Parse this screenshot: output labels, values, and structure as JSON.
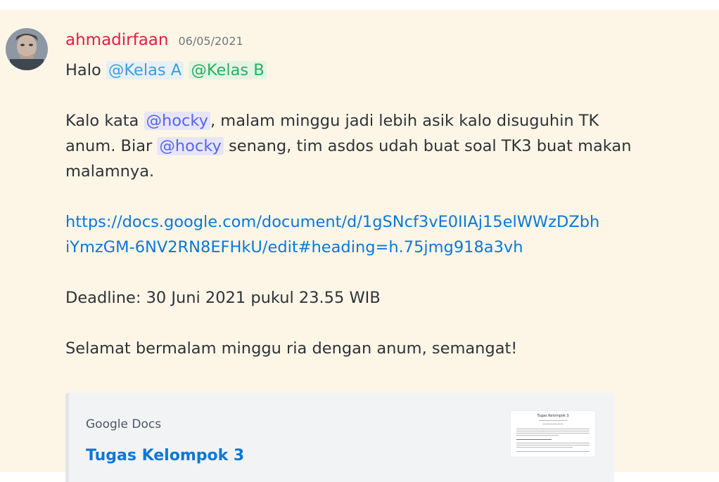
{
  "message": {
    "username": "ahmadirfaan",
    "timestamp": "06/05/2021",
    "greeting": "Halo",
    "role_mention_a": "@Kelas A",
    "role_mention_b": "@Kelas B",
    "para1_prefix": "Kalo kata",
    "user_mention": "@hocky",
    "para1_middle": ", malam minggu jadi lebih asik kalo disuguhin TK",
    "para1_line2_prefix": "anum. Biar",
    "para1_line2_suffix": "senang, tim asdos udah buat soal TK3 buat makan",
    "para1_line3": "malamnya.",
    "link_line1": "https://docs.google.com/document/d/1gSNcf3vE0IIAj15elWWzDZbh",
    "link_line2": "iYmzGM-6NV2RN8EFHkU/edit#heading=h.75jmg918a3vh",
    "deadline": "Deadline: 30 Juni 2021 pukul 23.55 WIB",
    "closing": "Selamat bermalam minggu ria dengan anum, semangat!"
  },
  "embed": {
    "provider": "Google Docs",
    "title": "Tugas Kelompok 3",
    "thumbnail_title": "Tugas Kelompok 3"
  },
  "colors": {
    "username": "#e11d48",
    "link": "#0b77d6",
    "highlight_background": "#fdf6e7",
    "role_mention_a": "#3b9edb",
    "role_mention_b": "#27ae60",
    "user_mention": "#5865f2"
  }
}
